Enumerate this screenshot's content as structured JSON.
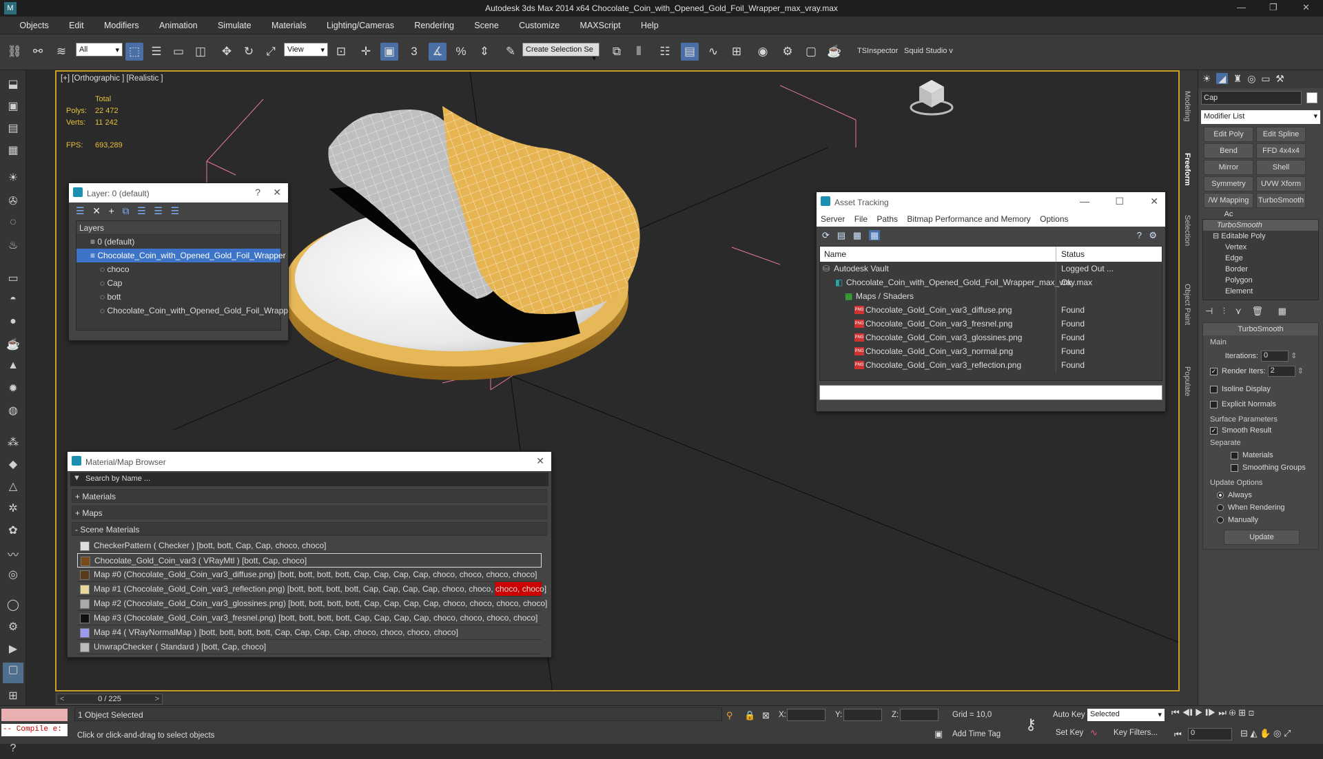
{
  "window": {
    "title": "Autodesk 3ds Max  2014 x64     Chocolate_Coin_with_Opened_Gold_Foil_Wrapper_max_vray.max"
  },
  "menu": [
    "Objects",
    "Edit",
    "Modifiers",
    "Animation",
    "Simulate",
    "Materials",
    "Lighting/Cameras",
    "Rendering",
    "Scene",
    "Customize",
    "MAXScript",
    "Help"
  ],
  "toolbar": {
    "filter": "All",
    "view": "View",
    "selection_set": "Create Selection Se",
    "tsinspector": "TSInspector",
    "squid": "Squid Studio v"
  },
  "viewport": {
    "label": "[+] [Orthographic ] [Realistic ]",
    "stats": {
      "total_label": "Total",
      "polys_label": "Polys:",
      "polys": "22 472",
      "verts_label": "Verts:",
      "verts": "11 242",
      "fps_label": "FPS:",
      "fps": "693,289"
    }
  },
  "layer_window": {
    "title": "Layer: 0 (default)",
    "header": "Layers",
    "items": [
      "0 (default)",
      "Chocolate_Coin_with_Opened_Gold_Foil_Wrapper",
      "choco",
      "Cap",
      "bott",
      "Chocolate_Coin_with_Opened_Gold_Foil_Wrapp"
    ]
  },
  "asset_tracking": {
    "title": "Asset Tracking",
    "menu": [
      "Server",
      "File",
      "Paths",
      "Bitmap Performance and Memory",
      "Options"
    ],
    "col_name": "Name",
    "col_status": "Status",
    "rows": [
      {
        "name": "Autodesk Vault",
        "status": "Logged Out ..."
      },
      {
        "name": "Chocolate_Coin_with_Opened_Gold_Foil_Wrapper_max_vray.max",
        "status": "Ok"
      },
      {
        "name": "Maps / Shaders",
        "status": ""
      },
      {
        "name": "Chocolate_Gold_Coin_var3_diffuse.png",
        "status": "Found"
      },
      {
        "name": "Chocolate_Gold_Coin_var3_fresnel.png",
        "status": "Found"
      },
      {
        "name": "Chocolate_Gold_Coin_var3_glossines.png",
        "status": "Found"
      },
      {
        "name": "Chocolate_Gold_Coin_var3_normal.png",
        "status": "Found"
      },
      {
        "name": "Chocolate_Gold_Coin_var3_reflection.png",
        "status": "Found"
      }
    ]
  },
  "material_browser": {
    "title": "Material/Map Browser",
    "search_placeholder": "Search by Name ...",
    "groups": [
      "+ Materials",
      "+ Maps",
      "- Scene Materials"
    ],
    "items": [
      "CheckerPattern  ( Checker ) [bott, bott, Cap, Cap, choco, choco]",
      "Chocolate_Gold_Coin_var3  ( VRayMtl ) [bott, Cap, choco]",
      "Map #0 (Chocolate_Gold_Coin_var3_diffuse.png) [bott, bott, bott, bott, Cap, Cap, Cap, Cap, choco, choco, choco, choco]",
      "Map #1 (Chocolate_Gold_Coin_var3_reflection.png) [bott, bott, bott, bott, Cap, Cap, Cap, Cap, choco, choco, choco, choco]",
      "Map #2 (Chocolate_Gold_Coin_var3_glossines.png) [bott, bott, bott, bott, Cap, Cap, Cap, Cap, choco, choco, choco, choco]",
      "Map #3 (Chocolate_Gold_Coin_var3_fresnel.png) [bott, bott, bott, bott, Cap, Cap, Cap, Cap, choco, choco, choco, choco]",
      "Map #4  ( VRayNormalMap ) [bott, bott, bott, bott, Cap, Cap, Cap, Cap, choco, choco, choco, choco]",
      "UnwrapChecker  ( Standard ) [bott, Cap, choco]"
    ]
  },
  "command_panel": {
    "object_name": "Cap",
    "modifier_list": "Modifier List",
    "buttons": [
      "Edit Poly",
      "Edit Spline",
      "Bend",
      "FFD 4x4x4",
      "Mirror",
      "Shell",
      "Symmetry",
      "UVW Xform",
      "/W Mapping Ac",
      "TurboSmooth"
    ],
    "stack": [
      "TurboSmooth",
      "Editable Poly",
      "Vertex",
      "Edge",
      "Border",
      "Polygon",
      "Element"
    ],
    "rollout_title": "TurboSmooth",
    "main_label": "Main",
    "iterations_label": "Iterations:",
    "iterations": "0",
    "render_iters_label": "Render Iters:",
    "render_iters": "2",
    "isoline": "Isoline Display",
    "explicit": "Explicit Normals",
    "surface_params": "Surface Parameters",
    "smooth_result": "Smooth Result",
    "separate": "Separate",
    "materials": "Materials",
    "smoothing_groups": "Smoothing Groups",
    "update_options": "Update Options",
    "always": "Always",
    "when_rendering": "When Rendering",
    "manually": "Manually",
    "update_btn": "Update"
  },
  "side_tabs": [
    "Modeling",
    "Freeform",
    "Selection",
    "Object Paint",
    "Populate"
  ],
  "status": {
    "frame": "0 / 225",
    "selected": "1 Object Selected",
    "prompt": "Click or click-and-drag to select objects",
    "compile": "-- Compile e:",
    "x_label": "X:",
    "y_label": "Y:",
    "z_label": "Z:",
    "grid": "Grid = 10,0",
    "add_time_tag": "Add Time Tag",
    "auto_key": "Auto Key",
    "set_key": "Set Key",
    "key_mode": "Selected",
    "key_filters": "Key Filters...",
    "frame_field": "0"
  }
}
